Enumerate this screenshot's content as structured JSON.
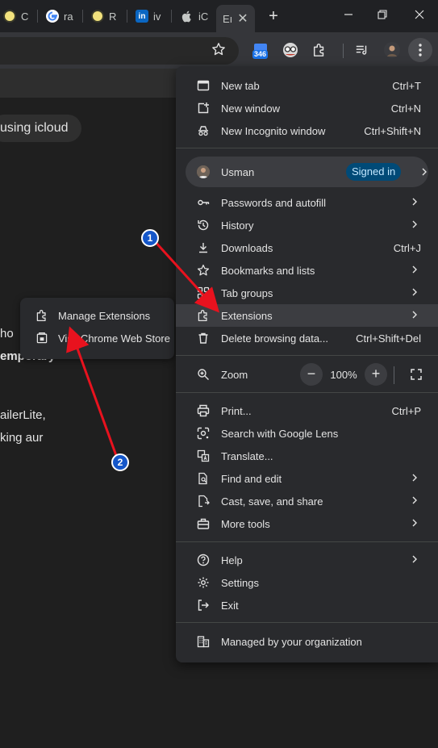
{
  "tabs": [
    {
      "label": "C",
      "icon": "yellow-circle-icon"
    },
    {
      "label": "ra",
      "icon": "google-icon"
    },
    {
      "label": "R",
      "icon": "yellow-circle-icon"
    },
    {
      "label": "iv",
      "icon": "linkedin-icon"
    },
    {
      "label": "iC",
      "icon": "apple-icon"
    },
    {
      "label": "Eı",
      "icon": "none",
      "active": true
    }
  ],
  "toolbar": {
    "extension_badge": "346"
  },
  "page": {
    "chip_text": "using icloud",
    "lines": [
      "ho",
      "emporary",
      "ailerLite,",
      "king aur"
    ]
  },
  "submenu": {
    "items": [
      {
        "label": "Manage Extensions",
        "icon": "puzzle-icon"
      },
      {
        "label": "Visit Chrome Web Store",
        "icon": "store-icon"
      }
    ]
  },
  "menu": {
    "group1": [
      {
        "label": "New tab",
        "shortcut": "Ctrl+T",
        "icon": "new-tab-icon"
      },
      {
        "label": "New window",
        "shortcut": "Ctrl+N",
        "icon": "new-window-icon"
      },
      {
        "label": "New Incognito window",
        "shortcut": "Ctrl+Shift+N",
        "icon": "incognito-icon"
      }
    ],
    "profile": {
      "name": "Usman",
      "status": "Signed in"
    },
    "group2": [
      {
        "label": "Passwords and autofill",
        "shortcut": "",
        "icon": "key-icon",
        "submenu": true
      },
      {
        "label": "History",
        "shortcut": "",
        "icon": "history-icon",
        "submenu": true
      },
      {
        "label": "Downloads",
        "shortcut": "Ctrl+J",
        "icon": "download-icon"
      },
      {
        "label": "Bookmarks and lists",
        "shortcut": "",
        "icon": "star-icon",
        "submenu": true
      },
      {
        "label": "Tab groups",
        "shortcut": "",
        "icon": "tab-groups-icon",
        "submenu": true
      },
      {
        "label": "Extensions",
        "shortcut": "",
        "icon": "puzzle-icon",
        "submenu": true,
        "highlighted": true
      },
      {
        "label": "Delete browsing data...",
        "shortcut": "Ctrl+Shift+Del",
        "icon": "trash-icon"
      }
    ],
    "zoom": {
      "label": "Zoom",
      "value": "100%",
      "minus": "−",
      "plus": "+"
    },
    "group3": [
      {
        "label": "Print...",
        "shortcut": "Ctrl+P",
        "icon": "print-icon"
      },
      {
        "label": "Search with Google Lens",
        "shortcut": "",
        "icon": "lens-icon"
      },
      {
        "label": "Translate...",
        "shortcut": "",
        "icon": "translate-icon"
      },
      {
        "label": "Find and edit",
        "shortcut": "",
        "icon": "find-icon",
        "submenu": true
      },
      {
        "label": "Cast, save, and share",
        "shortcut": "",
        "icon": "cast-icon",
        "submenu": true
      },
      {
        "label": "More tools",
        "shortcut": "",
        "icon": "toolbox-icon",
        "submenu": true
      }
    ],
    "group4": [
      {
        "label": "Help",
        "icon": "help-icon",
        "submenu": true
      },
      {
        "label": "Settings",
        "icon": "gear-icon"
      },
      {
        "label": "Exit",
        "icon": "exit-icon"
      }
    ],
    "managed": {
      "label": "Managed by your organization",
      "icon": "building-icon"
    }
  },
  "annotations": {
    "step1": "1",
    "step2": "2",
    "arrow_color": "#e8121e"
  }
}
